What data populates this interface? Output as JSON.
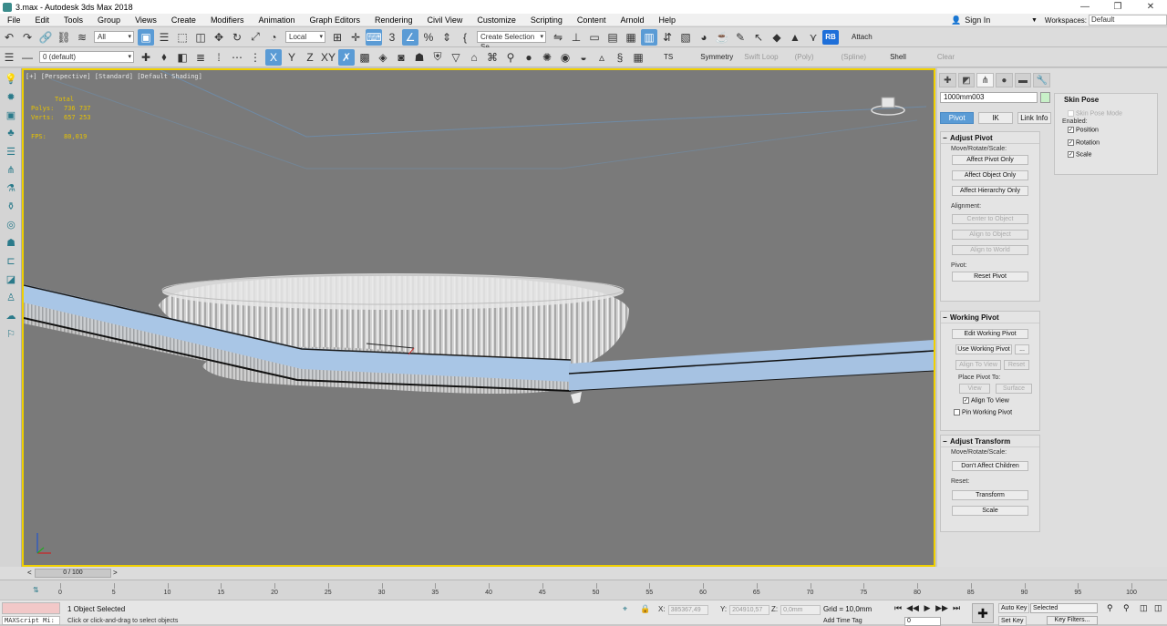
{
  "window": {
    "title": "3.max - Autodesk 3ds Max 2018",
    "controls": [
      "—",
      "❐",
      "✕"
    ]
  },
  "menu": [
    "File",
    "Edit",
    "Tools",
    "Group",
    "Views",
    "Create",
    "Modifiers",
    "Animation",
    "Graph Editors",
    "Rendering",
    "Civil View",
    "Customize",
    "Scripting",
    "Content",
    "Arnold",
    "Help"
  ],
  "account": {
    "sign_in": "Sign In",
    "workspaces_label": "Workspaces:",
    "workspace": "Default"
  },
  "toolbar1": {
    "filter": "All",
    "ref_coord": "Local",
    "selection_set": "Create Selection Se",
    "rb_badge": "RB",
    "attach": "Attach"
  },
  "toolbar2": {
    "layer": "0 (default)",
    "axis_x": "X",
    "axis_y": "Y",
    "axis_z": "Z",
    "axis_xy": "XY",
    "ts": "TS",
    "symmetry": "Symmetry",
    "swift_loop": "Swift Loop",
    "poly": "(Poly)",
    "spline": "(Spline)",
    "shell": "Shell",
    "clear": "Clear"
  },
  "viewport": {
    "label": "[+] [Perspective] [Standard] [Default Shading]",
    "stats": {
      "total": "Total",
      "polys_label": "Polys:",
      "polys": "736 737",
      "verts_label": "Verts:",
      "verts": "657 253",
      "fps_label": "FPS:",
      "fps": "80,019"
    }
  },
  "command_panel": {
    "object_name": "1000mm003",
    "pivot_tabs": [
      "Pivot",
      "IK",
      "Link Info"
    ],
    "adjust_pivot": {
      "header": "Adjust Pivot",
      "move_label": "Move/Rotate/Scale:",
      "btn_pivot_only": "Affect Pivot Only",
      "btn_object_only": "Affect Object Only",
      "btn_hierarchy_only": "Affect Hierarchy Only",
      "alignment_label": "Alignment:",
      "btn_center": "Center to Object",
      "btn_align_object": "Align to Object",
      "btn_align_world": "Align to World",
      "pivot_label": "Pivot:",
      "btn_reset": "Reset Pivot"
    },
    "working_pivot": {
      "header": "Working Pivot",
      "btn_edit": "Edit Working Pivot",
      "btn_use": "Use Working Pivot",
      "btn_more": "...",
      "btn_align_view": "Align To View",
      "btn_reset": "Reset",
      "place_label": "Place Pivot To:",
      "btn_view": "View",
      "btn_surface": "Surface",
      "chk_align_view": "Align To View",
      "chk_pin": "Pin Working Pivot"
    },
    "adjust_transform": {
      "header": "Adjust Transform",
      "move_label": "Move/Rotate/Scale:",
      "btn_dont_affect": "Don't Affect Children",
      "reset_label": "Reset:",
      "btn_transform": "Transform",
      "btn_scale": "Scale"
    },
    "skin_pose": {
      "header": "Skin Pose",
      "mode": "Skin Pose Mode",
      "enabled": "Enabled:",
      "position": "Position",
      "rotation": "Rotation",
      "scale": "Scale"
    }
  },
  "timeline": {
    "slider": "0 / 100",
    "ticks": [
      "0",
      "5",
      "10",
      "15",
      "20",
      "25",
      "30",
      "35",
      "40",
      "45",
      "50",
      "55",
      "60",
      "65",
      "70",
      "75",
      "80",
      "85",
      "90",
      "95",
      "100"
    ]
  },
  "status": {
    "maxscript": "MAXScript Mi:",
    "selected": "1 Object Selected",
    "hint": "Click or click-and-drag to select objects",
    "x_label": "X:",
    "x": "385367,49",
    "y_label": "Y:",
    "y": "204910,57",
    "z_label": "Z:",
    "z": "0,0mm",
    "grid": "Grid = 10,0mm",
    "add_time_tag": "Add Time Tag",
    "auto_key": "Auto Key",
    "set_key": "Set Key",
    "selected_mode": "Selected",
    "key_filters": "Key Filters...",
    "frame": "0"
  }
}
